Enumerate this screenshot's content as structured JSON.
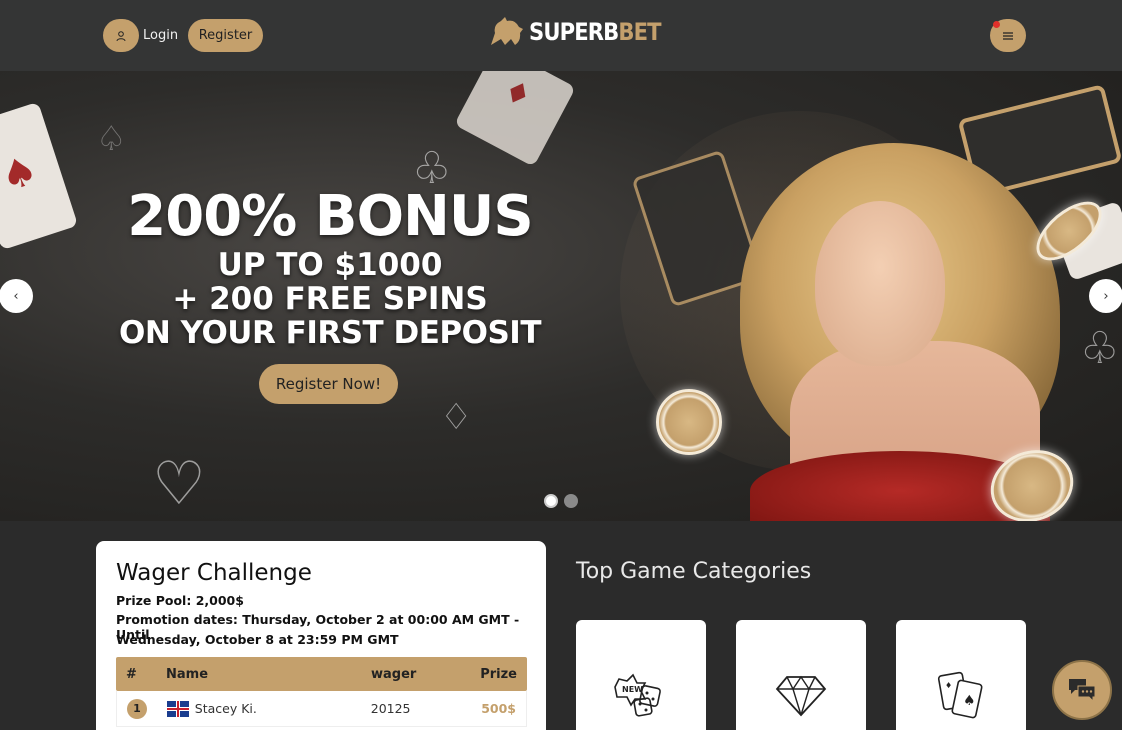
{
  "header": {
    "login_label": "Login",
    "register_label": "Register",
    "logo_text": "SUPERB",
    "logo_text_accent": "BET",
    "user_icon": "user-icon",
    "menu_icon": "hamburger-menu-icon"
  },
  "hero": {
    "line1": "200% BONUS",
    "line2": "UP TO $1000",
    "line3": "+ 200 FREE SPINS",
    "line4": "ON YOUR FIRST DEPOSIT",
    "cta_label": "Register Now!",
    "prev_icon": "chevron-left-icon",
    "next_icon": "chevron-right-icon",
    "slides": 2,
    "active_slide": 1
  },
  "wager": {
    "title": "Wager Challenge",
    "prize_pool": "Prize Pool: 2,000$",
    "promo_line1": "Promotion dates: Thursday, October 2 at 00:00 AM GMT - Until",
    "promo_line2": "Wednesday, October 8 at 23:59 PM GMT",
    "columns": [
      "#",
      "Name",
      "wager",
      "Prize"
    ],
    "rows": [
      {
        "rank": "1",
        "name": "Stacey Ki.",
        "wager": "20125",
        "prize": "500$"
      }
    ]
  },
  "categories": {
    "title": "Top Game Categories",
    "items": [
      {
        "icon": "new-dice-icon"
      },
      {
        "icon": "diamond-icon"
      },
      {
        "icon": "playing-cards-icon"
      }
    ]
  },
  "chat": {
    "icon": "chat-bubbles-icon"
  },
  "colors": {
    "accent": "#c4a06c",
    "header_bg": "#343535",
    "page_bg": "#2b2b2b"
  }
}
